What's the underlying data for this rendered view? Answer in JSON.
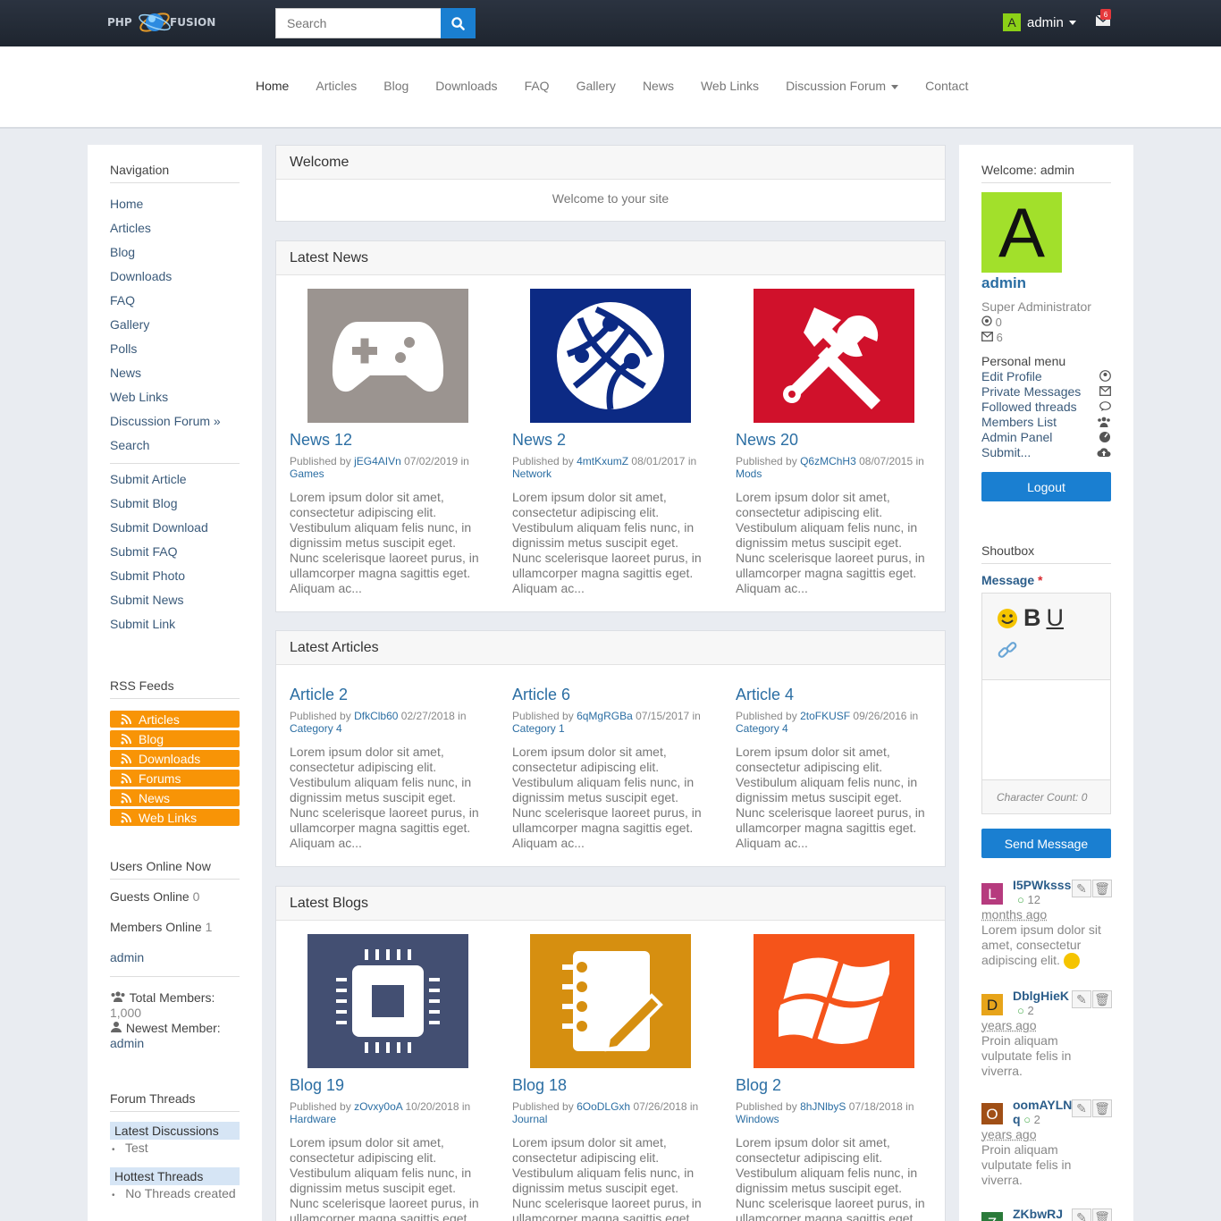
{
  "header": {
    "logo_alt": "PHP FUSION",
    "search_placeholder": "Search",
    "user_initial": "A",
    "user_name": "admin",
    "mail_count": "6"
  },
  "menu": [
    "Home",
    "Articles",
    "Blog",
    "Downloads",
    "FAQ",
    "Gallery",
    "News",
    "Web Links",
    "Discussion Forum",
    "Contact"
  ],
  "left": {
    "nav_title": "Navigation",
    "nav_items": [
      "Home",
      "Articles",
      "Blog",
      "Downloads",
      "FAQ",
      "Gallery",
      "Polls",
      "News",
      "Web Links",
      "Discussion Forum »",
      "Search"
    ],
    "submit_items": [
      "Submit Article",
      "Submit Blog",
      "Submit Download",
      "Submit FAQ",
      "Submit Photo",
      "Submit News",
      "Submit Link"
    ],
    "rss_title": "RSS Feeds",
    "rss_items": [
      "Articles",
      "Blog",
      "Downloads",
      "Forums",
      "News",
      "Web Links"
    ],
    "online_title": "Users Online Now",
    "guests_label": "Guests Online",
    "guests_count": "0",
    "members_label": "Members Online",
    "members_count": "1",
    "online_user": "admin",
    "total_members_label": "Total Members:",
    "total_members": "1,000",
    "newest_label": "Newest Member:",
    "newest_member": "admin",
    "forum_title": "Forum Threads",
    "latest_disc": "Latest Discussions",
    "latest_disc_item": "Test",
    "hottest": "Hottest Threads",
    "hottest_item": "No Threads created"
  },
  "welcome": {
    "title": "Welcome",
    "text": "Welcome to your site"
  },
  "lorem": "Lorem ipsum dolor sit amet, consectetur adipiscing elit. Vestibulum aliquam felis nunc, in dignissim metus suscipit eget. Nunc scelerisque laoreet purus, in ullamcorper magna sagittis eget. Aliquam ac...",
  "news": {
    "title": "Latest News",
    "items": [
      {
        "title": "News 12",
        "author": "jEG4AIVn",
        "date": "07/02/2019",
        "cat": "Games",
        "color": "#9b9490",
        "icon": "gamepad-icon"
      },
      {
        "title": "News 2",
        "author": "4mtKxumZ",
        "date": "08/01/2017",
        "cat": "Network",
        "color": "#0c2a84",
        "icon": "globe-network-icon"
      },
      {
        "title": "News 20",
        "author": "Q6zMChH3",
        "date": "08/07/2015",
        "cat": "Mods",
        "color": "#d0112b",
        "icon": "tools-icon"
      }
    ]
  },
  "articles": {
    "title": "Latest Articles",
    "items": [
      {
        "title": "Article 2",
        "author": "DfkClb60",
        "date": "02/27/2018",
        "cat": "Category 4"
      },
      {
        "title": "Article 6",
        "author": "6qMgRGBa",
        "date": "07/15/2017",
        "cat": "Category 1"
      },
      {
        "title": "Article 4",
        "author": "2toFKUSF",
        "date": "09/26/2016",
        "cat": "Category 4"
      }
    ]
  },
  "blogs": {
    "title": "Latest Blogs",
    "items": [
      {
        "title": "Blog 19",
        "author": "zOvxy0oA",
        "date": "10/20/2018",
        "cat": "Hardware",
        "color": "#434f72",
        "icon": "chip-icon"
      },
      {
        "title": "Blog 18",
        "author": "6OoDLGxh",
        "date": "07/26/2018",
        "cat": "Journal",
        "color": "#d68f10",
        "icon": "notebook-icon"
      },
      {
        "title": "Blog 2",
        "author": "8hJNlbyS",
        "date": "07/18/2018",
        "cat": "Windows",
        "color": "#f5541a",
        "icon": "windows-icon"
      }
    ]
  },
  "published_by": "Published by",
  "in_word": "in",
  "right": {
    "welcome": "Welcome: admin",
    "avatar_letter": "A",
    "name": "admin",
    "role": "Super Administrator",
    "points": "0",
    "messages": "6",
    "pm_title": "Personal menu",
    "pm_items": [
      "Edit Profile",
      "Private Messages",
      "Followed threads",
      "Members List",
      "Admin Panel",
      "Submit..."
    ],
    "logout": "Logout",
    "shoutbox": "Shoutbox",
    "message_label": "Message",
    "required": "*",
    "bold": "B",
    "underline": "U",
    "char_count": "Character Count: 0",
    "send": "Send Message",
    "shouts": [
      {
        "name": "I5PWksss",
        "initial": "L",
        "color": "#b63b7e",
        "count": "12",
        "ago": "months ago",
        "text": "Lorem ipsum dolor sit amet, consectetur adipiscing elit."
      },
      {
        "name": "DblgHieK",
        "initial": "D",
        "color": "#e7a41a",
        "count": "2",
        "ago": "years ago",
        "text": "Proin aliquam vulputate felis in viverra."
      },
      {
        "name": "oomAYLN",
        "name2": "q",
        "initial": "O",
        "color": "#a04f16",
        "count": "2",
        "ago": "years ago",
        "text": "Proin aliquam vulputate felis in viverra."
      },
      {
        "name": "ZKbwRJ",
        "initial": "Z",
        "color": "#2a7a3a"
      }
    ]
  }
}
